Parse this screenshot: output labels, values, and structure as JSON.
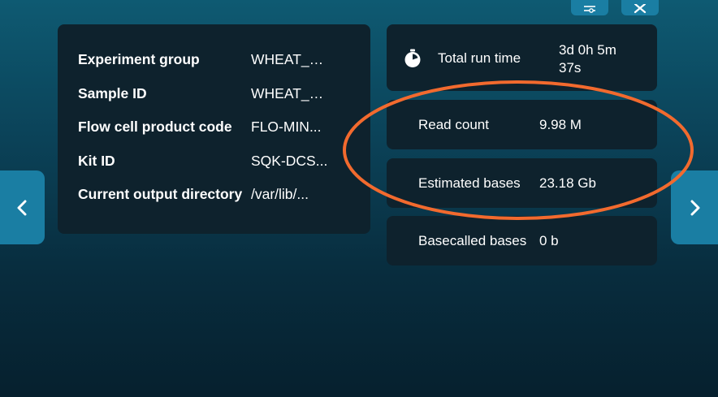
{
  "toolbar": {
    "settings_icon": "settings-sliders-icon",
    "close_icon": "close-icon"
  },
  "run_info": {
    "rows": [
      {
        "label": "Experiment group",
        "value": "WHEAT_S..."
      },
      {
        "label": "Sample ID",
        "value": "WHEAT_S..."
      },
      {
        "label": "Flow cell product code",
        "value": "FLO-MIN..."
      },
      {
        "label": "Kit ID",
        "value": "SQK-DCS..."
      },
      {
        "label": "Current output directory",
        "value": "/var/lib/..."
      }
    ]
  },
  "stats": {
    "runtime": {
      "label": "Total run time",
      "value": "3d 0h 5m 37s",
      "icon": "stopwatch-icon"
    },
    "read_count": {
      "label": "Read count",
      "value": "9.98 M"
    },
    "estimated_bases": {
      "label": "Estimated bases",
      "value": "23.18 Gb"
    },
    "basecalled_bases": {
      "label": "Basecalled bases",
      "value": "0 b"
    }
  },
  "navigation": {
    "prev_icon": "chevron-left-icon",
    "next_icon": "chevron-right-icon"
  },
  "colors": {
    "accent": "#1a7ea3",
    "card_bg": "#0e222d",
    "annotation": "#f26a2e"
  }
}
